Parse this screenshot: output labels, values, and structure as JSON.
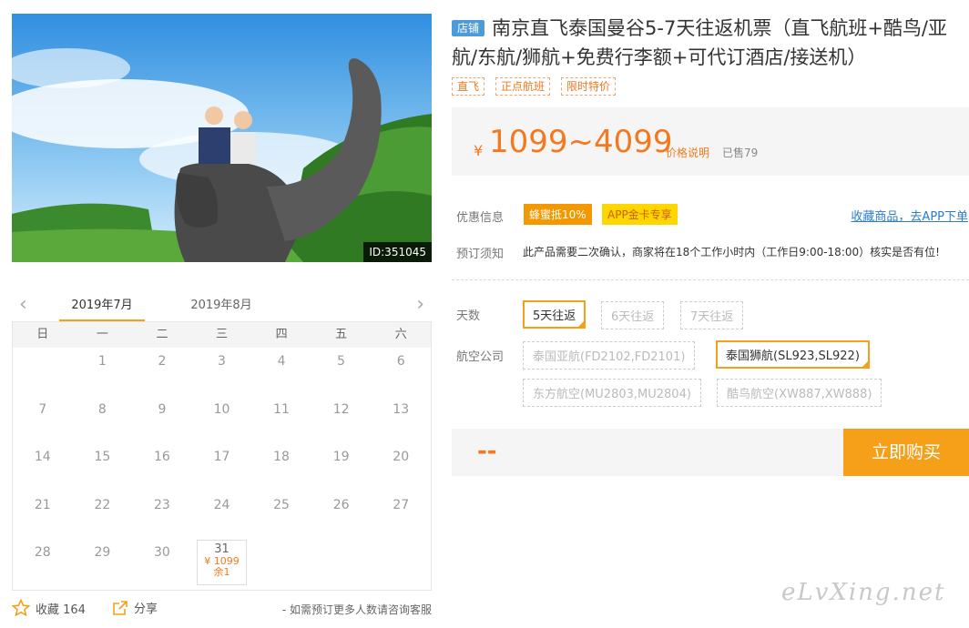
{
  "photo": {
    "id_label": "ID:351045"
  },
  "calendar": {
    "months": [
      "2019年7月",
      "2019年8月"
    ],
    "weekdays": [
      "日",
      "一",
      "二",
      "三",
      "四",
      "五",
      "六"
    ],
    "days": [
      "",
      "1",
      "2",
      "3",
      "4",
      "5",
      "6",
      "7",
      "8",
      "9",
      "10",
      "11",
      "12",
      "13",
      "14",
      "15",
      "16",
      "17",
      "18",
      "19",
      "20",
      "21",
      "22",
      "23",
      "24",
      "25",
      "26",
      "27",
      "28",
      "29",
      "30"
    ],
    "available": {
      "day": "31",
      "price": "¥ 1099",
      "remain": "余1"
    }
  },
  "footer": {
    "favorite_label": "收藏 164",
    "share_label": "分享",
    "consult_note": "- 如需预订更多人数请咨询客服"
  },
  "product": {
    "shop_badge": "店铺",
    "title": "南京直飞泰国曼谷5-7天往返机票（直飞航班+酷鸟/亚航/东航/狮航+免费行李额+可代订酒店/接送机）",
    "tags": [
      "直飞",
      "正点航班",
      "限时特价"
    ],
    "price_symbol": "¥",
    "price_range": "1099~4099",
    "price_note": "价格说明",
    "sold": "已售79"
  },
  "promo": {
    "label": "优惠信息",
    "items": [
      "蜂蜜抵10%",
      "APP金卡专享"
    ],
    "app_link": "收藏商品，去APP下单"
  },
  "booking": {
    "label": "预订须知",
    "notice": "此产品需要二次确认，商家将在18个工作小时内（工作日9:00-18:00）核实是否有位!"
  },
  "options": {
    "days_label": "天数",
    "days": [
      "5天往返",
      "6天往返",
      "7天往返"
    ],
    "days_selected": "5天往返",
    "airline_label": "航空公司",
    "airlines": [
      "泰国亚航(FD2102,FD2101)",
      "泰国狮航(SL923,SL922)",
      "东方航空(MU2803,MU2804)",
      "酷鸟航空(XW887,XW888)"
    ],
    "airline_selected": "泰国狮航(SL923,SL922)"
  },
  "buy": {
    "price_placeholder": "--",
    "button_label": "立即购买"
  },
  "watermark": "eLvXing.net",
  "colors": {
    "accent": "#f6a01a",
    "price": "#f3781f",
    "link": "#2c7ec6",
    "badge": "#4d9bd8"
  }
}
